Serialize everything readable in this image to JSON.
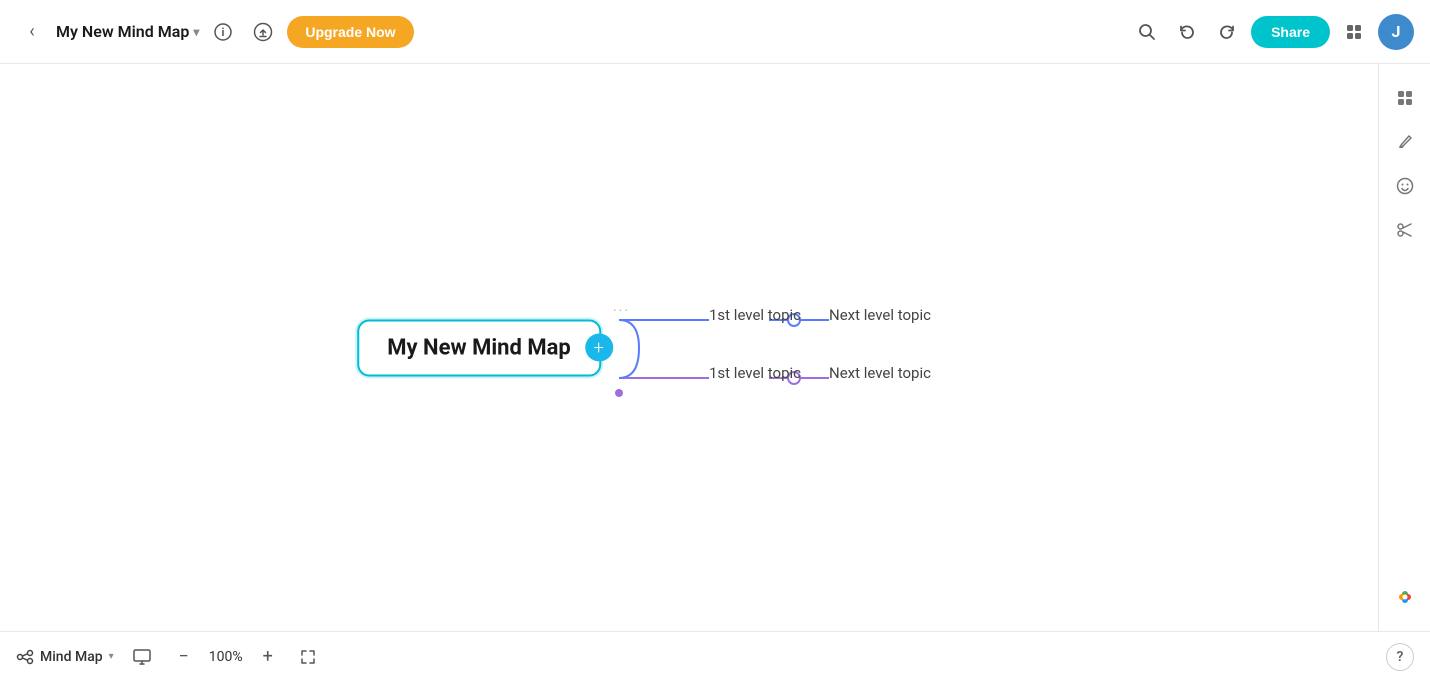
{
  "header": {
    "back_label": "‹",
    "title": "My New Mind Map",
    "title_chevron": "▾",
    "info_icon": "ℹ",
    "upload_icon": "⬆",
    "upgrade_label": "Upgrade Now",
    "search_icon": "🔍",
    "undo_icon": "↩",
    "redo_icon": "↪",
    "share_label": "Share",
    "apps_label": "apps",
    "avatar_label": "J"
  },
  "mindmap": {
    "central_label": "My New Mind Map",
    "plus_icon": "+",
    "branch_top_label": "1st level topic",
    "branch_bottom_label": "1st level topic",
    "next_top_label": "Next level topic",
    "next_bottom_label": "Next level topic",
    "dots": "···"
  },
  "sidebar": {
    "grid_icon": "⊞",
    "brush_icon": "✏",
    "emoji_icon": "☺",
    "scissors_icon": "✂",
    "flower_icon": "✿"
  },
  "bottom": {
    "mode_icon": "✂",
    "mode_label": "Mind Map",
    "mode_chevron": "▾",
    "presentation_icon": "▶",
    "zoom_minus": "−",
    "zoom_level": "100%",
    "zoom_plus": "+",
    "fullscreen_icon": "⛶",
    "help_icon": "?"
  }
}
